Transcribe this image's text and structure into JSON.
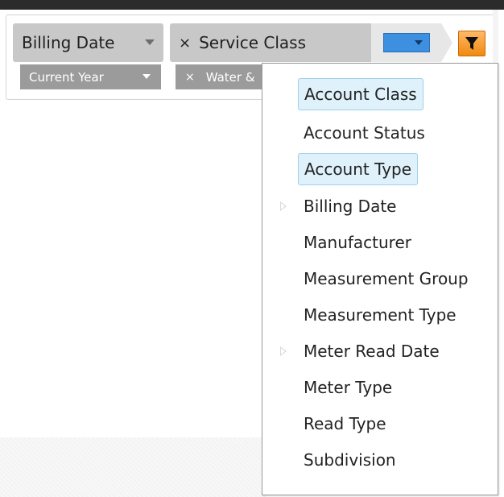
{
  "breadcrumb": {
    "billing_label": "Billing Date",
    "service_label": "Service Class",
    "service_remove": "×",
    "selector_value": ""
  },
  "subfilters": {
    "year_label": "Current Year",
    "water_label": "Water &",
    "water_remove": "×"
  },
  "menu": {
    "items": [
      {
        "label": "Account Class",
        "highlighted": true,
        "expandable": false
      },
      {
        "label": "Account Status",
        "highlighted": false,
        "expandable": false
      },
      {
        "label": "Account Type",
        "highlighted": true,
        "expandable": false
      },
      {
        "label": "Billing Date",
        "highlighted": false,
        "expandable": true
      },
      {
        "label": "Manufacturer",
        "highlighted": false,
        "expandable": false
      },
      {
        "label": "Measurement Group",
        "highlighted": false,
        "expandable": false
      },
      {
        "label": "Measurement Type",
        "highlighted": false,
        "expandable": false
      },
      {
        "label": "Meter Read Date",
        "highlighted": false,
        "expandable": true
      },
      {
        "label": "Meter Type",
        "highlighted": false,
        "expandable": false
      },
      {
        "label": "Read Type",
        "highlighted": false,
        "expandable": false
      },
      {
        "label": "Subdivision",
        "highlighted": false,
        "expandable": false
      }
    ]
  },
  "icons": {
    "filter": "filter-icon",
    "caret": "chevron-down-icon",
    "expand": "expand-arrow-icon"
  },
  "colors": {
    "accent_blue": "#3d8fe0",
    "filter_orange": "#f08a10",
    "chip_gray": "#c8c8c8",
    "selection_blue": "#dff1fa"
  }
}
